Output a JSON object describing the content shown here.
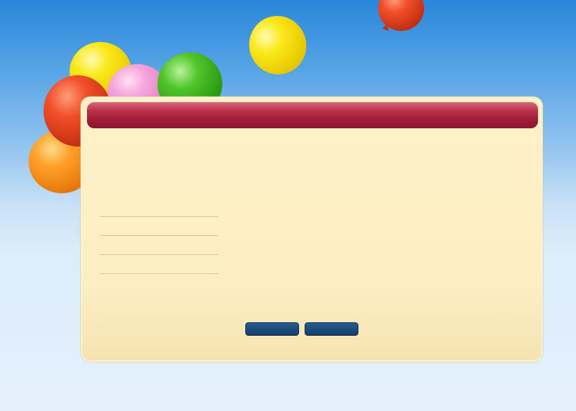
{
  "dialog": {
    "title": "",
    "fields": [
      {
        "value": "",
        "placeholder": ""
      },
      {
        "value": "",
        "placeholder": ""
      },
      {
        "value": "",
        "placeholder": ""
      },
      {
        "value": "",
        "placeholder": ""
      }
    ],
    "buttons": [
      {
        "label": ""
      },
      {
        "label": ""
      }
    ]
  },
  "colors": {
    "sky_top": "#2a86d9",
    "sky_bottom": "#e4f0fc",
    "panel": "#fdefc3",
    "title_bar": "#a5203c",
    "button": "#1b4c7a"
  },
  "decorations": {
    "balloons": [
      "orange-balloon-icon",
      "red-balloon-icon",
      "yellow-balloon-icon",
      "pink-balloon-icon",
      "green-balloon-icon",
      "yellow-balloon-icon",
      "red-balloon-icon"
    ]
  }
}
